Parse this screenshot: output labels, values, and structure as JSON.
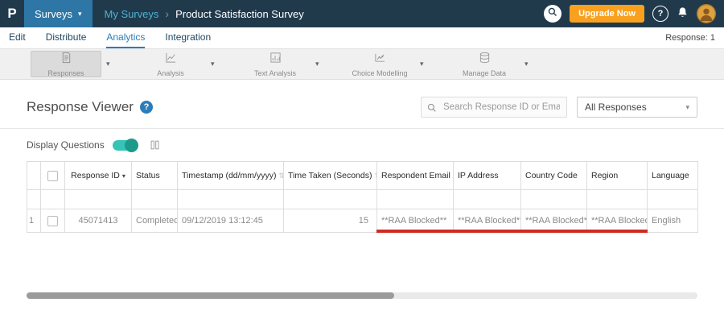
{
  "header": {
    "logo_text": "P",
    "surveys_label": "Surveys",
    "breadcrumb_parent": "My Surveys",
    "breadcrumb_current": "Product Satisfaction Survey",
    "upgrade_label": "Upgrade Now",
    "help_glyph": "?"
  },
  "tabs": {
    "items": [
      {
        "label": "Edit",
        "active": false
      },
      {
        "label": "Distribute",
        "active": false
      },
      {
        "label": "Analytics",
        "active": true
      },
      {
        "label": "Integration",
        "active": false
      }
    ],
    "response_count": "Response: 1"
  },
  "ribbon": {
    "items": [
      {
        "label": "Responses",
        "selected": true
      },
      {
        "label": "Analysis",
        "selected": false
      },
      {
        "label": "Text Analysis",
        "selected": false
      },
      {
        "label": "Choice Modelling",
        "selected": false
      },
      {
        "label": "Manage Data",
        "selected": false
      }
    ]
  },
  "viewer": {
    "title": "Response Viewer",
    "help_glyph": "?",
    "search_placeholder": "Search Response ID or Email",
    "responses_filter": "All Responses",
    "display_questions": "Display Questions"
  },
  "table": {
    "headers": {
      "response_id": "Response ID",
      "status": "Status",
      "timestamp": "Timestamp (dd/mm/yyyy)",
      "time_taken": "Time Taken (Seconds)",
      "respondent_email": "Respondent Email",
      "ip_address": "IP Address",
      "country_code": "Country Code",
      "region": "Region",
      "language": "Language"
    },
    "rows": [
      {
        "num": "1",
        "response_id": "45071413",
        "status": "Completed",
        "timestamp": "09/12/2019 13:12:45",
        "time_taken": "15",
        "respondent_email": "**RAA Blocked**",
        "ip_address": "**RAA Blocked**",
        "country_code": "**RAA Blocked**",
        "region": "**RAA Blocked**",
        "language": "English"
      }
    ]
  },
  "icons": {
    "caret_down": "▾",
    "breadcrumb_sep": "›",
    "sort_desc": "▾",
    "sort_both": "⇅"
  },
  "colors": {
    "header_bg": "#203a4c",
    "surveys_button_blue": "#2d76a6",
    "breadcrumb_link": "#4db3d4",
    "accent_blue": "#2b7cb9",
    "upgrade_orange": "#f9a11e",
    "toggle_teal": "#35c4b5",
    "link_teal": "#2e9fae",
    "annotation_red": "#cf2b22"
  }
}
